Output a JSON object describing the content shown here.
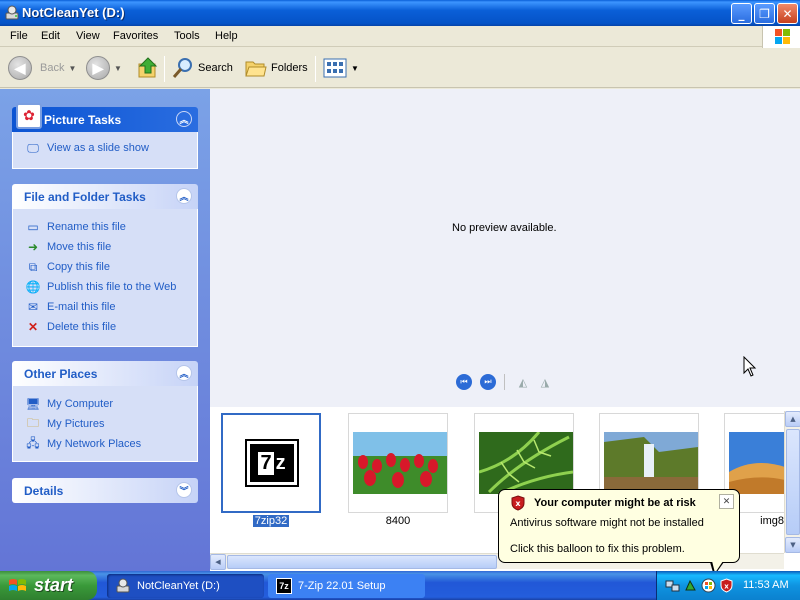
{
  "window": {
    "title": "NotCleanYet (D:)",
    "menus": [
      "File",
      "Edit",
      "View",
      "Favorites",
      "Tools",
      "Help"
    ]
  },
  "toolbar": {
    "back_label": "Back",
    "search_label": "Search",
    "folders_label": "Folders"
  },
  "sidebar": {
    "picture_tasks": {
      "title": "Picture Tasks",
      "items": [
        {
          "label": "View as a slide show",
          "icon": "slideshow-icon"
        }
      ]
    },
    "file_folder_tasks": {
      "title": "File and Folder Tasks",
      "items": [
        {
          "label": "Rename this file",
          "icon": "rename-icon"
        },
        {
          "label": "Move this file",
          "icon": "move-icon"
        },
        {
          "label": "Copy this file",
          "icon": "copy-icon"
        },
        {
          "label": "Publish this file to the Web",
          "icon": "publish-icon"
        },
        {
          "label": "E-mail this file",
          "icon": "email-icon"
        },
        {
          "label": "Delete this file",
          "icon": "delete-icon"
        }
      ]
    },
    "other_places": {
      "title": "Other Places",
      "items": [
        {
          "label": "My Computer",
          "icon": "computer-icon"
        },
        {
          "label": "My Pictures",
          "icon": "pictures-folder-icon"
        },
        {
          "label": "My Network Places",
          "icon": "network-icon"
        }
      ]
    },
    "details": {
      "title": "Details"
    }
  },
  "preview": {
    "message": "No preview available."
  },
  "filmstrip": {
    "items": [
      {
        "label": "7zip32",
        "selected": true
      },
      {
        "label": "8400",
        "selected": false
      },
      {
        "label": "",
        "selected": false
      },
      {
        "label": "",
        "selected": false
      },
      {
        "label": "img8",
        "selected": false
      }
    ]
  },
  "balloon": {
    "title": "Your computer might be at risk",
    "line1": "Antivirus software might not be installed",
    "line2": "Click this balloon to fix this problem."
  },
  "taskbar": {
    "start_label": "start",
    "tasks": [
      {
        "label": "NotCleanYet (D:)"
      },
      {
        "label": "7-Zip 22.01 Setup"
      }
    ],
    "clock": "11:53 AM"
  },
  "colors": {
    "titlebar": "#0a5fd8",
    "sidebar_link": "#215dc6",
    "selection": "#316ac5",
    "balloon_bg": "#ffffe1",
    "start_green": "#3a9a3a"
  }
}
